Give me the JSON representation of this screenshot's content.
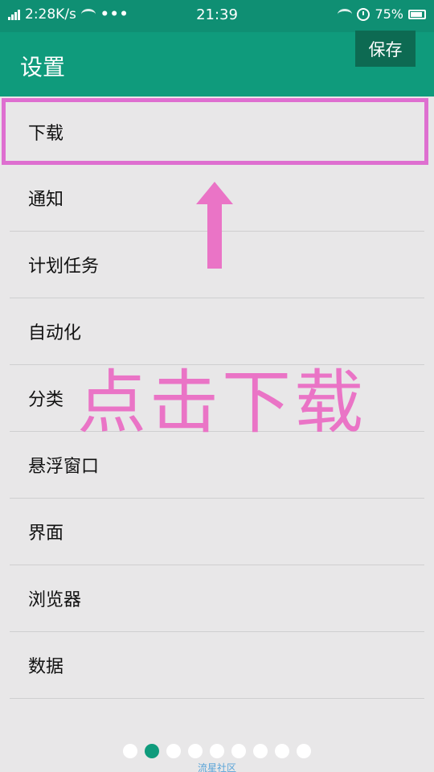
{
  "status_bar": {
    "speed": "2:28K/s",
    "time": "21:39",
    "right_text": "75%"
  },
  "app_bar": {
    "title": "设置",
    "save_label": "保存"
  },
  "settings": {
    "items": [
      {
        "label": "下载"
      },
      {
        "label": "通知"
      },
      {
        "label": "计划任务"
      },
      {
        "label": "自动化"
      },
      {
        "label": "分类"
      },
      {
        "label": "悬浮窗口"
      },
      {
        "label": "界面"
      },
      {
        "label": "浏览器"
      },
      {
        "label": "数据"
      }
    ]
  },
  "annotation": {
    "text": "点击下载",
    "color": "#ea74c6"
  },
  "pager": {
    "count": 9,
    "active_index": 1
  },
  "footer": {
    "text": "流星社区"
  },
  "colors": {
    "primary": "#0f9b7c",
    "save_button": "#0d6a52",
    "highlight_border": "#de6fd0"
  }
}
